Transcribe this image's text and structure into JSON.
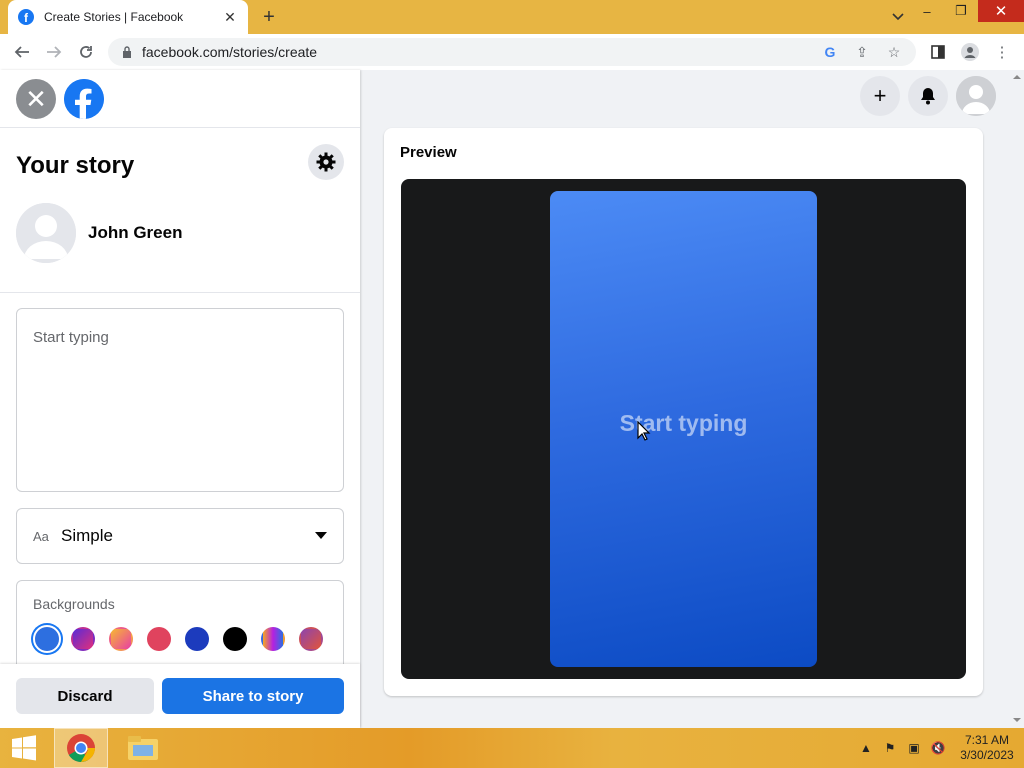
{
  "browser": {
    "tab_title": "Create Stories | Facebook",
    "url": "facebook.com/stories/create"
  },
  "sidebar": {
    "heading": "Your story",
    "user_name": "John Green",
    "text_placeholder": "Start typing",
    "font_icon": "Aa",
    "font_value": "Simple",
    "backgrounds_label": "Backgrounds",
    "swatches": [
      "#2d6fe0",
      "#a4279e",
      "#f58529",
      "#e0435e",
      "#1c3bbd",
      "#000000",
      "#6a4bd6",
      "#d6462d"
    ],
    "discard_label": "Discard",
    "share_label": "Share to story"
  },
  "preview": {
    "label": "Preview",
    "story_text": "Start typing"
  },
  "taskbar": {
    "time": "7:31 AM",
    "date": "3/30/2023"
  },
  "colors": {
    "accent": "#1877f2",
    "share_button": "#1b74e4"
  }
}
